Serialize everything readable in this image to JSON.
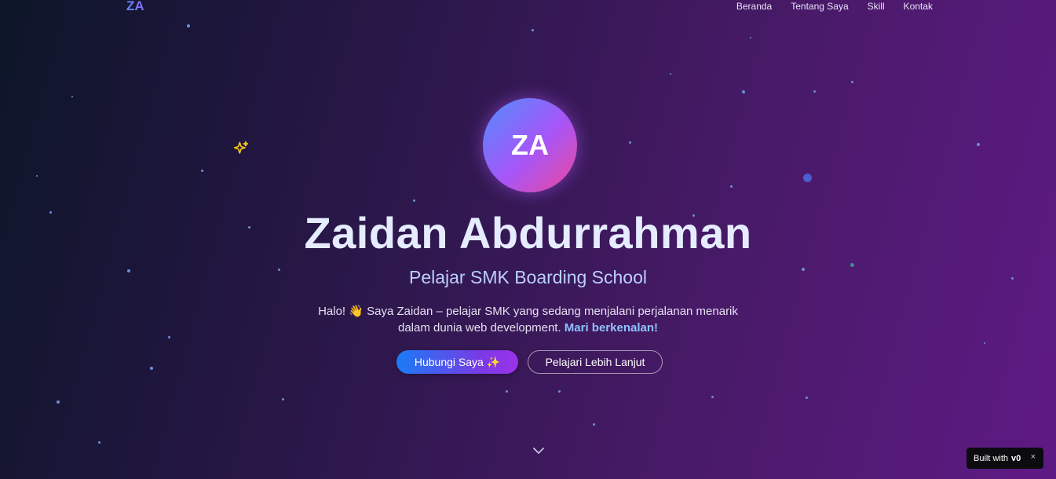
{
  "nav": {
    "logo": "ZA",
    "links": [
      "Beranda",
      "Tentang Saya",
      "Skill",
      "Kontak"
    ]
  },
  "hero": {
    "avatar_initials": "ZA",
    "name": "Zaidan Abdurrahman",
    "subtitle": "Pelajar SMK Boarding School",
    "intro_text": "Halo! 👋 Saya Zaidan – pelajar SMK yang sedang menjalani perjalanan menarik dalam dunia web development.",
    "intro_highlight": "Mari berkenalan!",
    "primary_button": "Hubungi Saya ✨",
    "secondary_button": "Pelajari Lebih Lanjut"
  },
  "badge": {
    "label": "Built with",
    "brand": "v0",
    "close": "×"
  },
  "icons": {
    "sparkle": "sparkle-icon",
    "scroll": "chevron-down-icon",
    "close": "close-icon"
  }
}
